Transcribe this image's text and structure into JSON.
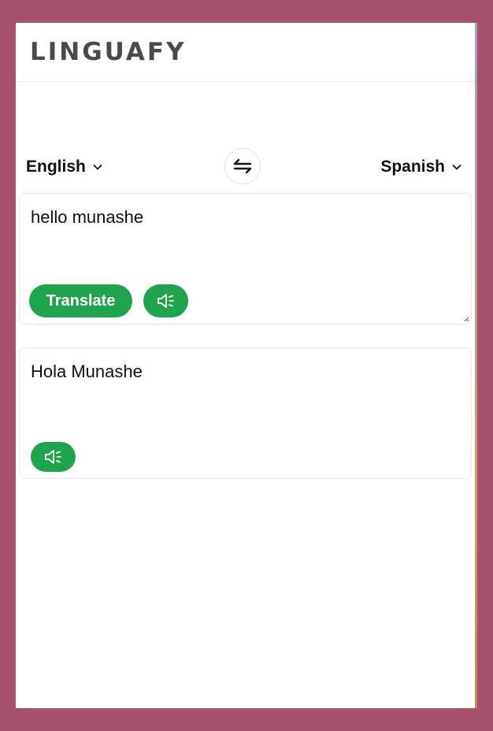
{
  "app": {
    "logo": "LINGUAFY"
  },
  "languages": {
    "from": "English",
    "to": "Spanish"
  },
  "input": {
    "value": "hello munashe"
  },
  "output": {
    "value": "Hola Munashe"
  },
  "buttons": {
    "translate_label": "Translate"
  },
  "icons": {
    "swap": "swap-arrows-icon",
    "chevron": "chevron-down-icon",
    "speaker": "speaker-icon"
  },
  "colors": {
    "background": "#a6506c",
    "accent": "#1fa34d",
    "logo": "#4a4a4a",
    "border": "#e4e7ee"
  }
}
